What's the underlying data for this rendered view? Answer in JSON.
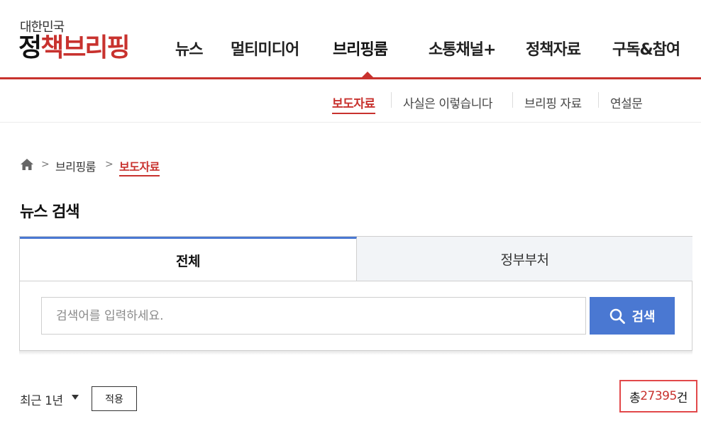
{
  "logo": {
    "top_text": "대한민국",
    "main_text_1": "정",
    "main_text_2": "책브리핑"
  },
  "gnb": {
    "items": [
      {
        "label": "뉴스"
      },
      {
        "label": "멀티미디어"
      },
      {
        "label": "브리핑룸"
      },
      {
        "label": "소통채널+"
      },
      {
        "label": "정책자료"
      },
      {
        "label": "구독&참여"
      }
    ],
    "active_index": 2
  },
  "subnav": {
    "items": [
      {
        "label": "보도자료"
      },
      {
        "label": "사실은 이렇습니다"
      },
      {
        "label": "브리핑 자료"
      },
      {
        "label": "연설문"
      }
    ],
    "active_index": 0
  },
  "breadcrumb": {
    "home_icon": "home-icon",
    "items": [
      {
        "label": "브리핑룸"
      },
      {
        "label": "보도자료"
      }
    ],
    "separator": ">"
  },
  "page_title": "뉴스 검색",
  "search": {
    "tabs": [
      {
        "label": "전체"
      },
      {
        "label": "정부부처"
      }
    ],
    "active_tab": 0,
    "placeholder": "검색어를 입력하세요.",
    "value": "",
    "button_label": "검색",
    "button_icon": "search-icon"
  },
  "filter": {
    "period_label": "최근 1년",
    "apply_label": "적용"
  },
  "total": {
    "prefix": "총 ",
    "count": "27395",
    "suffix": "건"
  },
  "colors": {
    "brand_red": "#c8322e",
    "accent_blue": "#4a78d2",
    "highlight_border": "#e2484a"
  }
}
